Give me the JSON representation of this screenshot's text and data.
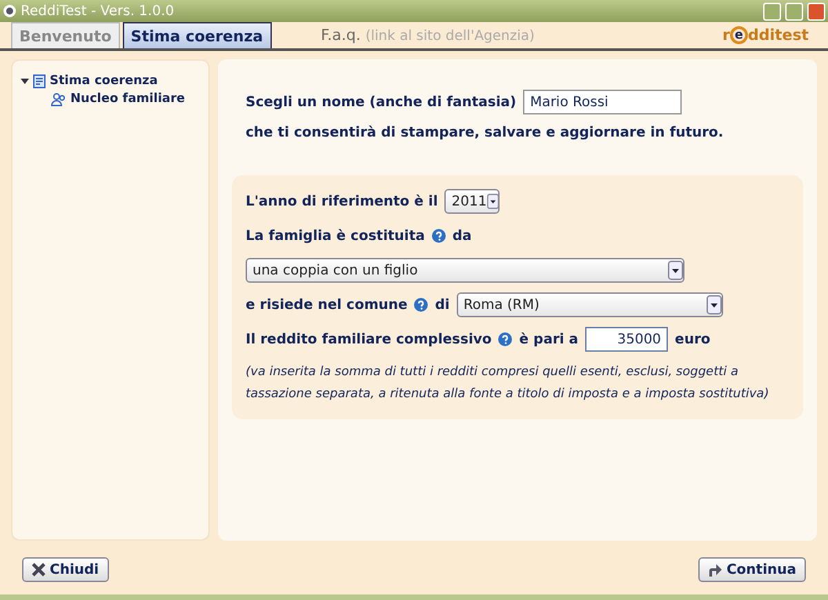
{
  "window": {
    "title": "ReddiTest - Vers. 1.0.0"
  },
  "tabs": [
    {
      "label": "Benvenuto",
      "selected": false
    },
    {
      "label": "Stima coerenza",
      "selected": true
    }
  ],
  "faq": {
    "label": "F.a.q.",
    "note": "(link al sito dell'Agenzia)"
  },
  "logo": {
    "lead": "r",
    "mark": "e",
    "rest": "dditest"
  },
  "tree": [
    {
      "label": "Stima coerenza",
      "expanded": true,
      "children": [
        {
          "label": "Nucleo familiare"
        }
      ]
    }
  ],
  "name_section": {
    "label": "Scegli un nome (anche di fantasia)",
    "value": "Mario Rossi",
    "note": "che ti consentirà di stampare, salvare e aggiornare in futuro."
  },
  "form": {
    "year": {
      "label": "L'anno di riferimento è il",
      "value": "2011"
    },
    "family": {
      "label": "La famiglia è costituita",
      "suffix": "da",
      "value": "una coppia con un figlio"
    },
    "comune": {
      "label": "e risiede nel comune",
      "suffix": "di",
      "value": "Roma (RM)"
    },
    "income": {
      "label": "Il reddito familiare complessivo",
      "suffix": "è pari a",
      "value": "35000",
      "unit": "euro"
    },
    "hint": "(va inserita la somma di tutti i redditi compresi quelli esenti, esclusi, soggetti a tassazione separata, a ritenuta alla fonte a titolo di imposta e a imposta sostitutiva)"
  },
  "buttons": [
    {
      "label": "Chiudi",
      "kind": "close"
    },
    {
      "label": "Continua",
      "kind": "next"
    }
  ]
}
